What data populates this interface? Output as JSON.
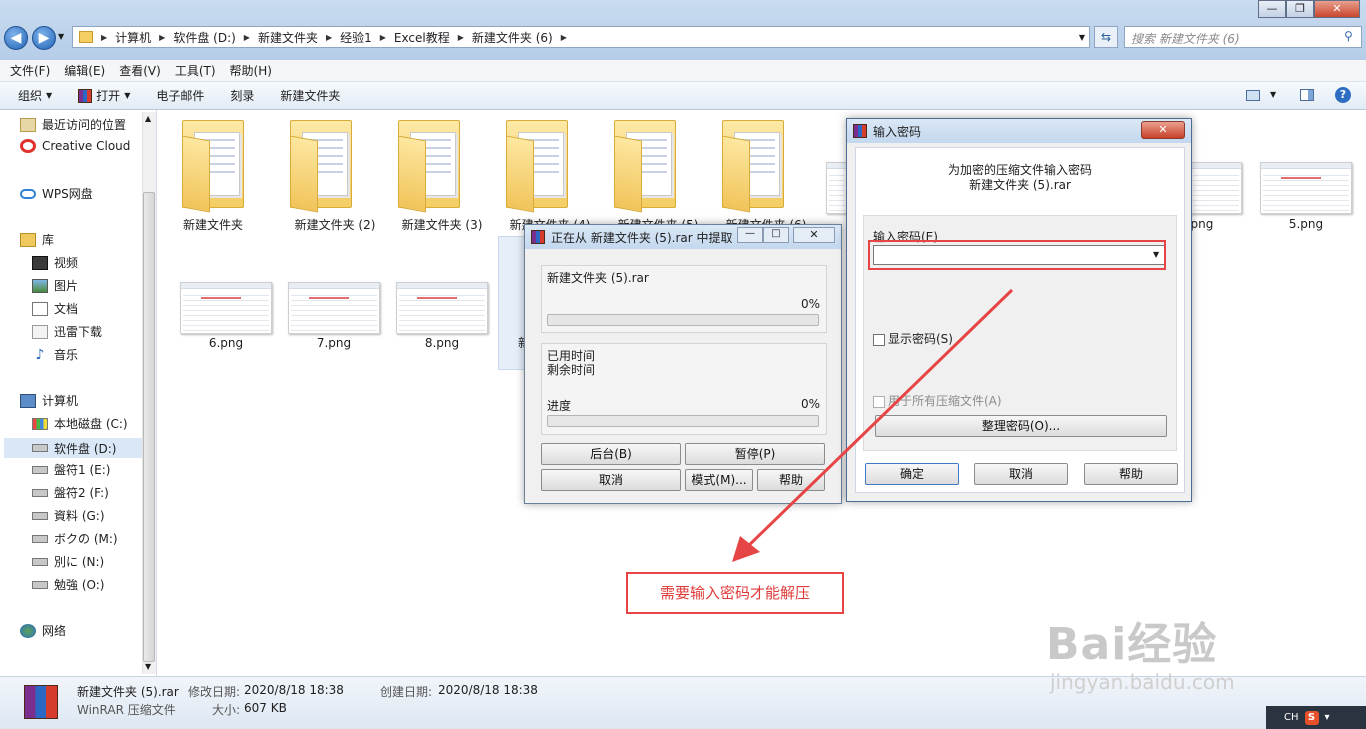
{
  "address": {
    "crumbs": [
      "计算机",
      "软件盘 (D:)",
      "新建文件夹",
      "经验1",
      "Excel教程",
      "新建文件夹 (6)"
    ],
    "search_placeholder": "搜索 新建文件夹 (6)"
  },
  "menu": [
    "文件(F)",
    "编辑(E)",
    "查看(V)",
    "工具(T)",
    "帮助(H)"
  ],
  "toolbar": {
    "organize": "组织",
    "open": "打开",
    "email": "电子邮件",
    "burn": "刻录",
    "new_folder": "新建文件夹"
  },
  "sidebar": {
    "recent": "最近访问的位置",
    "creative_cloud": "Creative Cloud",
    "wps": "WPS网盘",
    "library": "库",
    "video": "视频",
    "pictures": "图片",
    "documents": "文档",
    "thunder": "迅雷下载",
    "music": "音乐",
    "computer": "计算机",
    "drives": [
      "本地磁盘 (C:)",
      "软件盘 (D:)",
      "盤符1 (E:)",
      "盤符2 (F:)",
      "資料 (G:)",
      "ボクの (M:)",
      "別に (N:)",
      "勉強 (O:)"
    ],
    "network": "网络"
  },
  "files": {
    "folders": [
      "新建文件夹",
      "新建文件夹 (2)",
      "新建文件夹 (3)",
      "新建文件夹 (4)",
      "新建文件夹 (5)",
      "新建文件夹 (6)"
    ],
    "images_row1": [
      ".png",
      "5.png"
    ],
    "images_row2": [
      "6.png",
      "7.png",
      "8.png"
    ],
    "partial": "新"
  },
  "status": {
    "name": "新建文件夹 (5).rar",
    "type": "WinRAR 压缩文件",
    "modified_label": "修改日期:",
    "modified": "2020/8/18 18:38",
    "created_label": "创建日期:",
    "created": "2020/8/18 18:38",
    "size_label": "大小:",
    "size": "607 KB"
  },
  "extract_dialog": {
    "title": "正在从 新建文件夹 (5).rar 中提取",
    "archive": "新建文件夹 (5).rar",
    "pct1": "0%",
    "elapsed": "已用时间",
    "remaining": "剩余时间",
    "progress_label": "进度",
    "pct2": "0%",
    "background_btn": "后台(B)",
    "pause_btn": "暂停(P)",
    "cancel_btn": "取消",
    "mode_btn": "模式(M)...",
    "help_btn": "帮助"
  },
  "password_dialog": {
    "title": "输入密码",
    "line1": "为加密的压缩文件输入密码",
    "line2": "新建文件夹 (5).rar",
    "field_label": "输入密码(E)",
    "field_value": "",
    "show_password": "显示密码(S)",
    "use_all": "用于所有压缩文件(A)",
    "organize_btn": "整理密码(O)...",
    "ok_btn": "确定",
    "cancel_btn": "取消",
    "help_btn": "帮助"
  },
  "annotation": "需要输入密码才能解压",
  "watermark": {
    "brand": "Bai经验",
    "url": "jingyan.baidu.com"
  },
  "tray": {
    "lang": "CH"
  },
  "colors": {
    "annotation_red": "#e64545",
    "folder_yellow": "#f4cd63"
  }
}
